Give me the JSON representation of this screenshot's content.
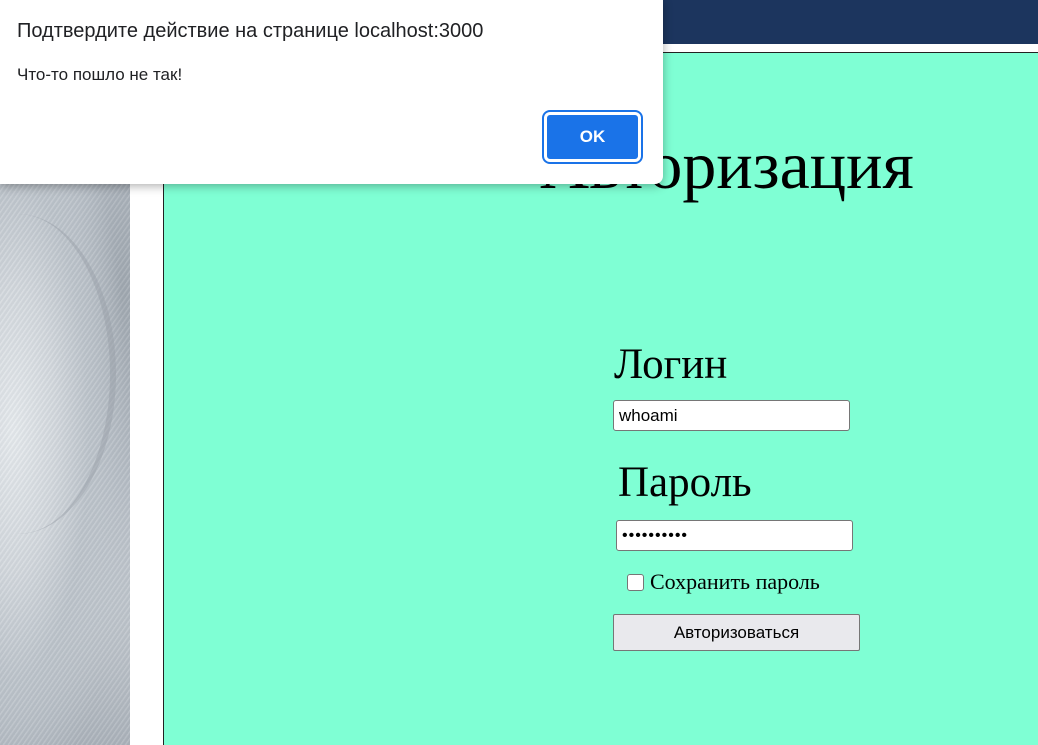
{
  "dialog": {
    "title": "Подтвердите действие на странице localhost:3000",
    "message": "Что-то пошло не так!",
    "ok_label": "OK"
  },
  "login_form": {
    "title": "Авторизация",
    "login_label": "Логин",
    "login_value": "whoami",
    "password_label": "Пароль",
    "password_value": "••••••••••",
    "remember_label": "Сохранить пароль",
    "remember_checked": false,
    "submit_label": "Авторизоваться"
  },
  "colors": {
    "header_bar": "#1c355e",
    "form_background": "#7fffd4",
    "dialog_button": "#1a73e8"
  }
}
